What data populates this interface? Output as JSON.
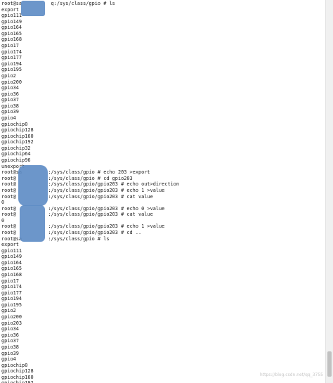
{
  "terminal": {
    "lines": [
      "root@sa          q:/sys/class/gpio # ls",
      "export",
      "gpio111",
      "gpio149",
      "gpio164",
      "gpio165",
      "gpio168",
      "gpio17",
      "gpio174",
      "gpio177",
      "gpio194",
      "gpio195",
      "gpio2",
      "gpio200",
      "gpio34",
      "gpio36",
      "gpio37",
      "gpio38",
      "gpio39",
      "gpio4",
      "gpiochip0",
      "gpiochip128",
      "gpiochip160",
      "gpiochip192",
      "gpiochip32",
      "gpiochip64",
      "gpiochip96",
      "unexport",
      "root@sa         :/sys/class/gpio # echo 203 >export",
      "root@           :/sys/class/gpio # cd gpio203",
      "root@           :/sys/class/gpio/gpio203 # echo out>direction",
      "root@           :/sys/class/gpio/gpio203 # echo 1 >value",
      "root@           :/sys/class/gpio/gpio203 # cat value",
      "0",
      "root@           :/sys/class/gpio/gpio203 # echo 0 >value",
      "root@           :/sys/class/gpio/gpio203 # cat value",
      "0",
      "root@           :/sys/class/gpio/gpio203 # echo 1 >value",
      "root@           :/sys/class/gpio/gpio203 # cd ..",
      "root@sa         :/sys/class/gpio # ls",
      "export",
      "gpio111",
      "gpio149",
      "gpio164",
      "gpio165",
      "gpio168",
      "gpio17",
      "gpio174",
      "gpio177",
      "gpio194",
      "gpio195",
      "gpio2",
      "gpio200",
      "gpio203",
      "gpio34",
      "gpio36",
      "gpio37",
      "gpio38",
      "gpio39",
      "gpio4",
      "gpiochip0",
      "gpiochip128",
      "gpiochip160",
      "gpiochip192"
    ],
    "watermark": "https://blog.csdn.net/qq_3755"
  },
  "colors": {
    "background": "#ffffff",
    "text": "#1b1b1b",
    "redaction": "#5f8dc6",
    "scrollbar_track": "#f0f0f0",
    "scrollbar_thumb": "#c1c1c1"
  }
}
